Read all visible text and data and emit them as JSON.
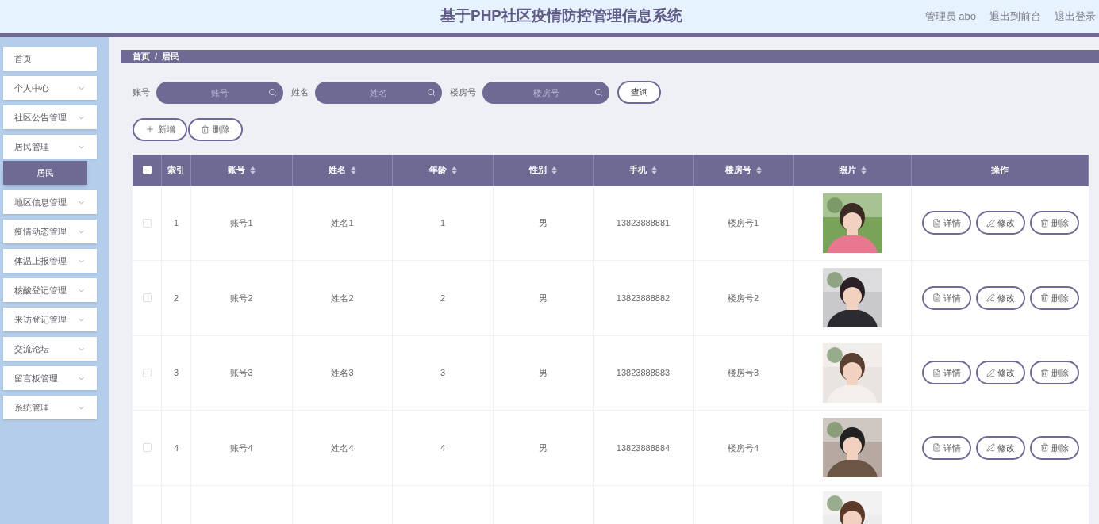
{
  "header": {
    "title": "基于PHP社区疫情防控管理信息系统",
    "links": [
      "管理员 abo",
      "退出到前台",
      "退出登录"
    ]
  },
  "sidebar": {
    "items": [
      {
        "label": "首页",
        "kind": "link"
      },
      {
        "label": "个人中心",
        "kind": "menu",
        "expanded": false
      },
      {
        "label": "社区公告管理",
        "kind": "menu",
        "expanded": false
      },
      {
        "label": "居民管理",
        "kind": "menu",
        "expanded": true,
        "children": [
          {
            "label": "居民",
            "selected": true
          }
        ]
      },
      {
        "label": "地区信息管理",
        "kind": "menu",
        "expanded": false
      },
      {
        "label": "疫情动态管理",
        "kind": "menu",
        "expanded": false
      },
      {
        "label": "体温上报管理",
        "kind": "menu",
        "expanded": false
      },
      {
        "label": "核酸登记管理",
        "kind": "menu",
        "expanded": false
      },
      {
        "label": "来访登记管理",
        "kind": "menu",
        "expanded": false
      },
      {
        "label": "交流论坛",
        "kind": "menu",
        "expanded": false
      },
      {
        "label": "留言板管理",
        "kind": "menu",
        "expanded": false
      },
      {
        "label": "系统管理",
        "kind": "menu",
        "expanded": false
      }
    ]
  },
  "breadcrumb": [
    "首页",
    "/",
    "居民"
  ],
  "search": {
    "fields": [
      {
        "label": "账号",
        "placeholder": "账号"
      },
      {
        "label": "姓名",
        "placeholder": "姓名"
      },
      {
        "label": "楼房号",
        "placeholder": "楼房号"
      }
    ],
    "button": "查询"
  },
  "toolbar": [
    {
      "label": "新增",
      "kind": "add"
    },
    {
      "label": "删除",
      "kind": "delete"
    }
  ],
  "table": {
    "select_all": {
      "checked": false
    },
    "columns": [
      {
        "label": "索引",
        "sortable": false
      },
      {
        "label": "账号",
        "sortable": true
      },
      {
        "label": "姓名",
        "sortable": true
      },
      {
        "label": "年龄",
        "sortable": true
      },
      {
        "label": "性别",
        "sortable": true
      },
      {
        "label": "手机",
        "sortable": true
      },
      {
        "label": "楼房号",
        "sortable": true
      },
      {
        "label": "照片",
        "sortable": true
      },
      {
        "label": "操作",
        "sortable": false
      }
    ],
    "rows": [
      {
        "checked": false,
        "cells": [
          "1",
          "账号1",
          "姓名1",
          "1",
          "男",
          "13823888881",
          "楼房号1"
        ],
        "photo": {
          "kind": "picture"
        },
        "actions": [
          {
            "label": "详情",
            "kind": "detail"
          },
          {
            "label": "修改",
            "kind": "edit"
          },
          {
            "label": "删除",
            "kind": "delete"
          }
        ]
      },
      {
        "checked": false,
        "cells": [
          "2",
          "账号2",
          "姓名2",
          "2",
          "男",
          "13823888882",
          "楼房号2"
        ],
        "photo": {
          "kind": "picture"
        },
        "actions": [
          {
            "label": "详情",
            "kind": "detail"
          },
          {
            "label": "修改",
            "kind": "edit"
          },
          {
            "label": "删除",
            "kind": "delete"
          }
        ]
      },
      {
        "checked": false,
        "cells": [
          "3",
          "账号3",
          "姓名3",
          "3",
          "男",
          "13823888883",
          "楼房号3"
        ],
        "photo": {
          "kind": "picture"
        },
        "actions": [
          {
            "label": "详情",
            "kind": "detail"
          },
          {
            "label": "修改",
            "kind": "edit"
          },
          {
            "label": "删除",
            "kind": "delete"
          }
        ]
      },
      {
        "checked": false,
        "cells": [
          "4",
          "账号4",
          "姓名4",
          "4",
          "男",
          "13823888884",
          "楼房号4"
        ],
        "photo": {
          "kind": "picture"
        },
        "actions": [
          {
            "label": "详情",
            "kind": "detail"
          },
          {
            "label": "修改",
            "kind": "edit"
          },
          {
            "label": "删除",
            "kind": "delete"
          }
        ]
      },
      {
        "photo": {
          "kind": "picture"
        }
      }
    ]
  }
}
